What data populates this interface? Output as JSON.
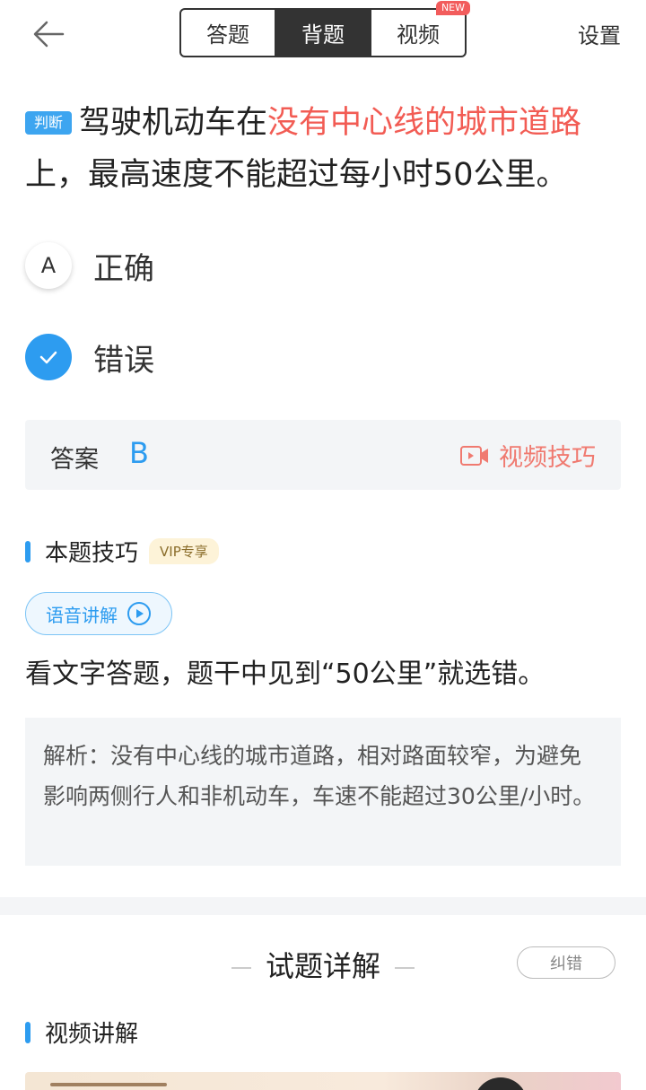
{
  "header": {
    "tabs": [
      "答题",
      "背题",
      "视频"
    ],
    "active_tab": 1,
    "new_badge": "NEW",
    "settings_label": "设置"
  },
  "question": {
    "tag": "判断",
    "text_before": "驾驶机动车在",
    "text_highlight": "没有中心线的城市道路",
    "text_after": "上，最高速度不能超过每小时50公里。",
    "highlight_color": "#f25c54"
  },
  "options": [
    {
      "key": "A",
      "label": "正确",
      "selected": false
    },
    {
      "key": "B",
      "label": "错误",
      "selected": true
    }
  ],
  "answer": {
    "label": "答案",
    "value": "B",
    "video_tip_label": "视频技巧"
  },
  "tip": {
    "title": "本题技巧",
    "vip_badge": "VIP专享",
    "voice_button": "语音讲解",
    "text": "看文字答题，题干中见到“50公里”就选错。"
  },
  "analysis": {
    "text": "解析：没有中心线的城市道路，相对路面较窄，为避免影响两侧行人和非机动车，车速不能超过30公里/小时。"
  },
  "details": {
    "title": "试题详解",
    "report_button": "纠错",
    "video_section_title": "视频讲解"
  },
  "colors": {
    "accent": "#2d9cf0",
    "danger": "#f25c54",
    "dark": "#333333"
  }
}
